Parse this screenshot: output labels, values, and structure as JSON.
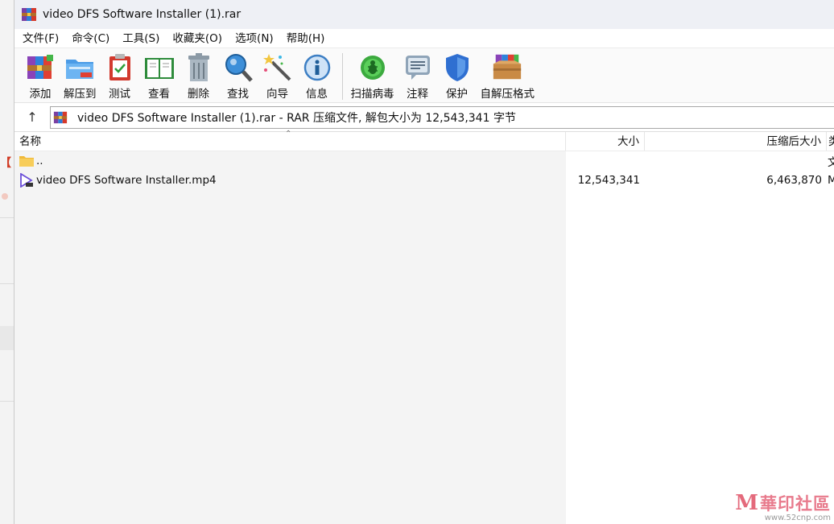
{
  "window": {
    "title": "video DFS Software Installer (1).rar"
  },
  "menu": [
    "文件(F)",
    "命令(C)",
    "工具(S)",
    "收藏夹(O)",
    "选项(N)",
    "帮助(H)"
  ],
  "toolbar": {
    "add": "添加",
    "extract_to": "解压到",
    "test": "测试",
    "view": "查看",
    "delete": "删除",
    "find": "查找",
    "wizard": "向导",
    "info": "信息",
    "virus_scan": "扫描病毒",
    "comment": "注释",
    "protect": "保护",
    "sfx": "自解压格式"
  },
  "address": {
    "text": "video DFS Software Installer (1).rar - RAR 压缩文件, 解包大小为 12,543,341 字节"
  },
  "columns": {
    "name": "名称",
    "size": "大小",
    "packed": "压缩后大小",
    "type": "类"
  },
  "files": [
    {
      "name": "..",
      "size": "",
      "packed": "",
      "type": "文"
    },
    {
      "name": "video DFS Software Installer.mp4",
      "size": "12,543,341",
      "packed": "6,463,870",
      "type": "M"
    }
  ],
  "background": {
    "mark": "【"
  },
  "watermark": {
    "logo": "M",
    "text": "華印社區",
    "url": "www.52cnp.com"
  },
  "colors": {
    "titlebar": "#eef0f5",
    "toolbar": "#fafafa",
    "name_column_bg": "#f4f4f4"
  }
}
